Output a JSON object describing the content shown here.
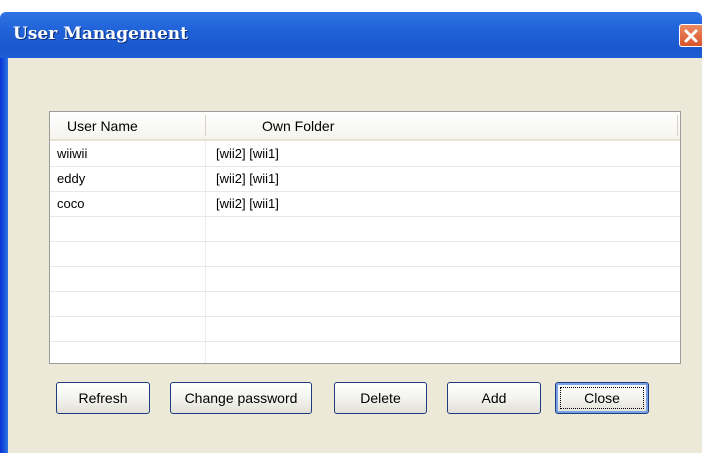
{
  "window": {
    "title": "User Management"
  },
  "table": {
    "columns": [
      "User Name",
      "Own Folder"
    ],
    "rows": [
      {
        "user": "wiiwii",
        "folder": "[wii2] [wii1]"
      },
      {
        "user": "eddy",
        "folder": "[wii2] [wii1]"
      },
      {
        "user": "coco",
        "folder": "[wii2] [wii1]"
      }
    ]
  },
  "buttons": {
    "refresh": "Refresh",
    "change_password": "Change password",
    "delete": "Delete",
    "add": "Add",
    "close": "Close"
  },
  "colors": {
    "titlebar": "#2062d8",
    "close_button": "#d9542a",
    "dialog_bg": "#ece9d8"
  },
  "icons": {
    "close": "close-icon"
  }
}
